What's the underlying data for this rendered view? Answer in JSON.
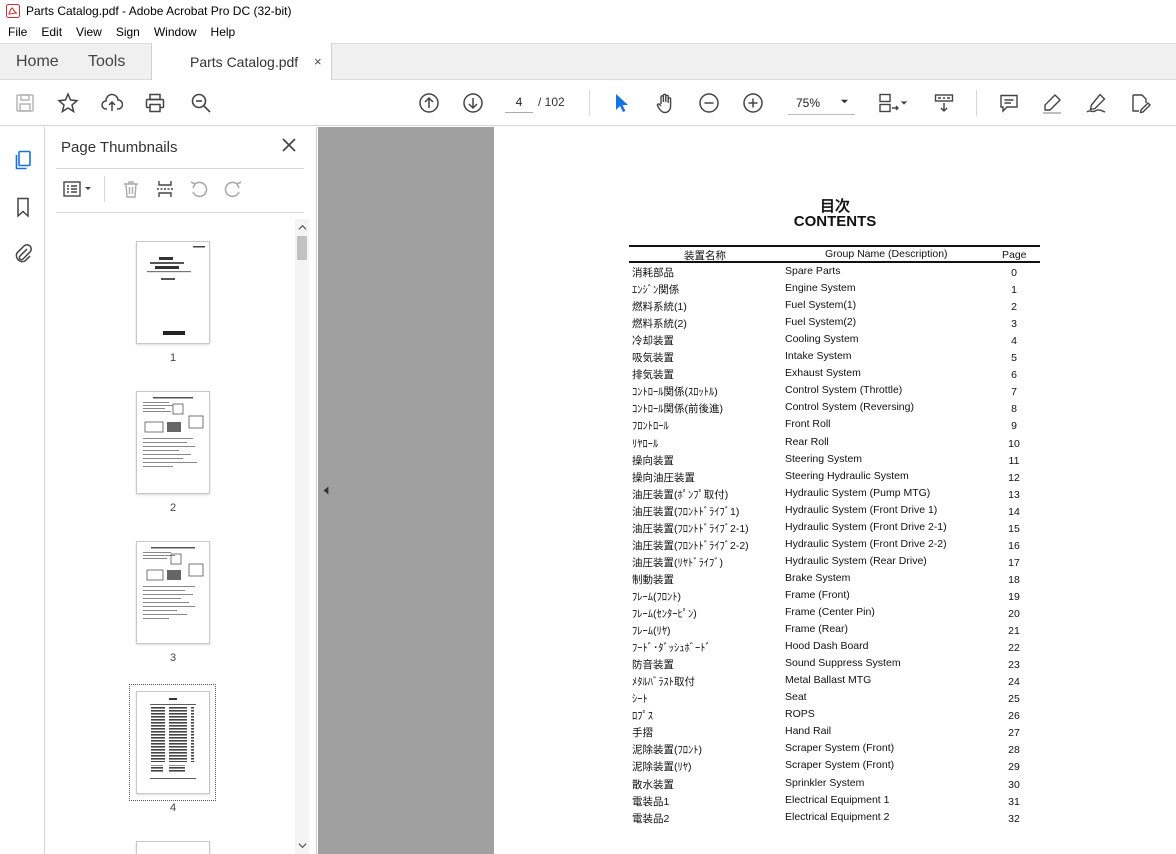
{
  "window": {
    "title": "Parts Catalog.pdf - Adobe Acrobat Pro DC (32-bit)"
  },
  "menu": [
    "File",
    "Edit",
    "View",
    "Sign",
    "Window",
    "Help"
  ],
  "tabs": {
    "home": "Home",
    "tools": "Tools",
    "document": "Parts Catalog.pdf",
    "close": "×"
  },
  "toolbar": {
    "current_page": "4",
    "total_pages": "/ 102",
    "zoom": "75%"
  },
  "panel": {
    "title": "Page Thumbnails",
    "thumbnails": [
      {
        "label": "1"
      },
      {
        "label": "2"
      },
      {
        "label": "3"
      },
      {
        "label": "4"
      }
    ]
  },
  "document": {
    "title_ja": "目次",
    "title_en": "CONTENTS",
    "headers": {
      "ja": "装置名称",
      "en": "Group Name (Description)",
      "page": "Page"
    },
    "rows": [
      {
        "ja": "消耗部品",
        "en": "Spare Parts",
        "page": "0"
      },
      {
        "ja": "ｴﾝｼﾞﾝ関係",
        "en": "Engine System",
        "page": "1"
      },
      {
        "ja": "燃料系統(1)",
        "en": "Fuel System(1)",
        "page": "2"
      },
      {
        "ja": "燃料系統(2)",
        "en": "Fuel System(2)",
        "page": "3"
      },
      {
        "ja": "冷却装置",
        "en": "Cooling System",
        "page": "4"
      },
      {
        "ja": "吸気装置",
        "en": "Intake System",
        "page": "5"
      },
      {
        "ja": "排気装置",
        "en": "Exhaust System",
        "page": "6"
      },
      {
        "ja": "ｺﾝﾄﾛｰﾙ関係(ｽﾛｯﾄﾙ)",
        "en": "Control System (Throttle)",
        "page": "7"
      },
      {
        "ja": "ｺﾝﾄﾛｰﾙ関係(前後進)",
        "en": "Control System (Reversing)",
        "page": "8"
      },
      {
        "ja": "ﾌﾛﾝﾄﾛｰﾙ",
        "en": "Front Roll",
        "page": "9"
      },
      {
        "ja": "ﾘﾔﾛｰﾙ",
        "en": "Rear Roll",
        "page": "10"
      },
      {
        "ja": "操向装置",
        "en": "Steering System",
        "page": "11"
      },
      {
        "ja": "操向油圧装置",
        "en": "Steering Hydraulic System",
        "page": "12"
      },
      {
        "ja": "油圧装置(ﾎﾟﾝﾌﾟ取付)",
        "en": "Hydraulic System (Pump MTG)",
        "page": "13"
      },
      {
        "ja": "油圧装置(ﾌﾛﾝﾄﾄﾞﾗｲﾌﾞ1)",
        "en": "Hydraulic System (Front Drive 1)",
        "page": "14"
      },
      {
        "ja": "油圧装置(ﾌﾛﾝﾄﾄﾞﾗｲﾌﾞ2-1)",
        "en": "Hydraulic System (Front Drive 2-1)",
        "page": "15"
      },
      {
        "ja": "油圧装置(ﾌﾛﾝﾄﾄﾞﾗｲﾌﾞ2-2)",
        "en": "Hydraulic System (Front Drive 2-2)",
        "page": "16"
      },
      {
        "ja": "油圧装置(ﾘﾔﾄﾞﾗｲﾌﾞ)",
        "en": "Hydraulic System (Rear Drive)",
        "page": "17"
      },
      {
        "ja": "制動装置",
        "en": "Brake System",
        "page": "18"
      },
      {
        "ja": "ﾌﾚｰﾑ(ﾌﾛﾝﾄ)",
        "en": "Frame (Front)",
        "page": "19"
      },
      {
        "ja": "ﾌﾚｰﾑ(ｾﾝﾀｰﾋﾟﾝ)",
        "en": "Frame (Center Pin)",
        "page": "20"
      },
      {
        "ja": "ﾌﾚｰﾑ(ﾘﾔ)",
        "en": "Frame (Rear)",
        "page": "21"
      },
      {
        "ja": "ﾌｰﾄﾞ･ﾀﾞｯｼｭﾎﾞｰﾄﾞ",
        "en": "Hood   Dash Board",
        "page": "22"
      },
      {
        "ja": "防音装置",
        "en": "Sound Suppress System",
        "page": "23"
      },
      {
        "ja": "ﾒﾀﾙﾊﾞﾗｽﾄ取付",
        "en": "Metal Ballast MTG",
        "page": "24"
      },
      {
        "ja": "ｼｰﾄ",
        "en": "Seat",
        "page": "25"
      },
      {
        "ja": "ﾛﾌﾟｽ",
        "en": "ROPS",
        "page": "26"
      },
      {
        "ja": "手摺",
        "en": "Hand Rail",
        "page": "27"
      },
      {
        "ja": "泥除装置(ﾌﾛﾝﾄ)",
        "en": "Scraper System (Front)",
        "page": "28"
      },
      {
        "ja": "泥除装置(ﾘﾔ)",
        "en": "Scraper System (Front)",
        "page": "29"
      },
      {
        "ja": "散水装置",
        "en": "Sprinkler System",
        "page": "30"
      },
      {
        "ja": "電装品1",
        "en": "Electrical Equipment 1",
        "page": "31"
      },
      {
        "ja": "電装品2",
        "en": "Electrical Equipment 2",
        "page": "32"
      }
    ]
  },
  "colors": {
    "accent": "#1473e6",
    "doc_background": "#a0a0a0",
    "tabbar": "#f0f0f0"
  }
}
